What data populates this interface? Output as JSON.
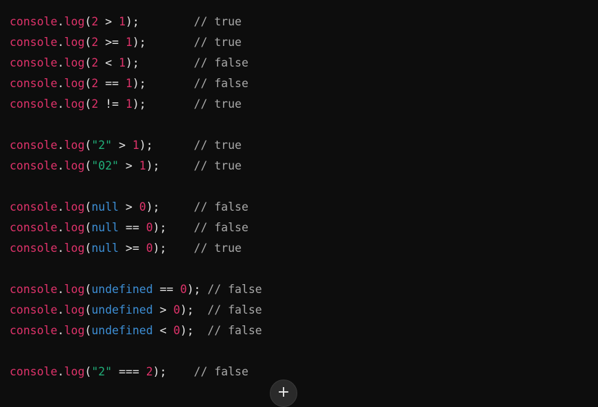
{
  "code": {
    "lines": [
      {
        "tokens": [
          [
            "obj",
            "console"
          ],
          [
            "op",
            "."
          ],
          [
            "fn",
            "log"
          ],
          [
            "op",
            "("
          ],
          [
            "num",
            "2"
          ],
          [
            "op",
            " > "
          ],
          [
            "num",
            "1"
          ],
          [
            "op",
            ");"
          ],
          [
            "op",
            "        "
          ],
          [
            "cm",
            "// true"
          ]
        ]
      },
      {
        "tokens": [
          [
            "obj",
            "console"
          ],
          [
            "op",
            "."
          ],
          [
            "fn",
            "log"
          ],
          [
            "op",
            "("
          ],
          [
            "num",
            "2"
          ],
          [
            "op",
            " >= "
          ],
          [
            "num",
            "1"
          ],
          [
            "op",
            ");"
          ],
          [
            "op",
            "       "
          ],
          [
            "cm",
            "// true"
          ]
        ]
      },
      {
        "tokens": [
          [
            "obj",
            "console"
          ],
          [
            "op",
            "."
          ],
          [
            "fn",
            "log"
          ],
          [
            "op",
            "("
          ],
          [
            "num",
            "2"
          ],
          [
            "op",
            " < "
          ],
          [
            "num",
            "1"
          ],
          [
            "op",
            ");"
          ],
          [
            "op",
            "        "
          ],
          [
            "cm",
            "// false"
          ]
        ]
      },
      {
        "tokens": [
          [
            "obj",
            "console"
          ],
          [
            "op",
            "."
          ],
          [
            "fn",
            "log"
          ],
          [
            "op",
            "("
          ],
          [
            "num",
            "2"
          ],
          [
            "op",
            " == "
          ],
          [
            "num",
            "1"
          ],
          [
            "op",
            ");"
          ],
          [
            "op",
            "       "
          ],
          [
            "cm",
            "// false"
          ]
        ]
      },
      {
        "tokens": [
          [
            "obj",
            "console"
          ],
          [
            "op",
            "."
          ],
          [
            "fn",
            "log"
          ],
          [
            "op",
            "("
          ],
          [
            "num",
            "2"
          ],
          [
            "op",
            " != "
          ],
          [
            "num",
            "1"
          ],
          [
            "op",
            ");"
          ],
          [
            "op",
            "       "
          ],
          [
            "cm",
            "// true"
          ]
        ]
      },
      {
        "blank": true
      },
      {
        "tokens": [
          [
            "obj",
            "console"
          ],
          [
            "op",
            "."
          ],
          [
            "fn",
            "log"
          ],
          [
            "op",
            "("
          ],
          [
            "str",
            "\"2\""
          ],
          [
            "op",
            " > "
          ],
          [
            "num",
            "1"
          ],
          [
            "op",
            ");"
          ],
          [
            "op",
            "      "
          ],
          [
            "cm",
            "// true"
          ]
        ]
      },
      {
        "tokens": [
          [
            "obj",
            "console"
          ],
          [
            "op",
            "."
          ],
          [
            "fn",
            "log"
          ],
          [
            "op",
            "("
          ],
          [
            "str",
            "\"02\""
          ],
          [
            "op",
            " > "
          ],
          [
            "num",
            "1"
          ],
          [
            "op",
            ");"
          ],
          [
            "op",
            "     "
          ],
          [
            "cm",
            "// true"
          ]
        ]
      },
      {
        "blank": true
      },
      {
        "tokens": [
          [
            "obj",
            "console"
          ],
          [
            "op",
            "."
          ],
          [
            "fn",
            "log"
          ],
          [
            "op",
            "("
          ],
          [
            "kw",
            "null"
          ],
          [
            "op",
            " > "
          ],
          [
            "num",
            "0"
          ],
          [
            "op",
            ");"
          ],
          [
            "op",
            "     "
          ],
          [
            "cm",
            "// false"
          ]
        ]
      },
      {
        "tokens": [
          [
            "obj",
            "console"
          ],
          [
            "op",
            "."
          ],
          [
            "fn",
            "log"
          ],
          [
            "op",
            "("
          ],
          [
            "kw",
            "null"
          ],
          [
            "op",
            " == "
          ],
          [
            "num",
            "0"
          ],
          [
            "op",
            ");"
          ],
          [
            "op",
            "    "
          ],
          [
            "cm",
            "// false"
          ]
        ]
      },
      {
        "tokens": [
          [
            "obj",
            "console"
          ],
          [
            "op",
            "."
          ],
          [
            "fn",
            "log"
          ],
          [
            "op",
            "("
          ],
          [
            "kw",
            "null"
          ],
          [
            "op",
            " >= "
          ],
          [
            "num",
            "0"
          ],
          [
            "op",
            ");"
          ],
          [
            "op",
            "    "
          ],
          [
            "cm",
            "// true"
          ]
        ]
      },
      {
        "blank": true
      },
      {
        "tokens": [
          [
            "obj",
            "console"
          ],
          [
            "op",
            "."
          ],
          [
            "fn",
            "log"
          ],
          [
            "op",
            "("
          ],
          [
            "kw",
            "undefined"
          ],
          [
            "op",
            " == "
          ],
          [
            "num",
            "0"
          ],
          [
            "op",
            ");"
          ],
          [
            "op",
            " "
          ],
          [
            "cm",
            "// false"
          ]
        ]
      },
      {
        "tokens": [
          [
            "obj",
            "console"
          ],
          [
            "op",
            "."
          ],
          [
            "fn",
            "log"
          ],
          [
            "op",
            "("
          ],
          [
            "kw",
            "undefined"
          ],
          [
            "op",
            " > "
          ],
          [
            "num",
            "0"
          ],
          [
            "op",
            ");"
          ],
          [
            "op",
            "  "
          ],
          [
            "cm",
            "// false"
          ]
        ]
      },
      {
        "tokens": [
          [
            "obj",
            "console"
          ],
          [
            "op",
            "."
          ],
          [
            "fn",
            "log"
          ],
          [
            "op",
            "("
          ],
          [
            "kw",
            "undefined"
          ],
          [
            "op",
            " < "
          ],
          [
            "num",
            "0"
          ],
          [
            "op",
            ");"
          ],
          [
            "op",
            "  "
          ],
          [
            "cm",
            "// false"
          ]
        ]
      },
      {
        "blank": true
      },
      {
        "tokens": [
          [
            "obj",
            "console"
          ],
          [
            "op",
            "."
          ],
          [
            "fn",
            "log"
          ],
          [
            "op",
            "("
          ],
          [
            "str",
            "\"2\""
          ],
          [
            "op",
            " === "
          ],
          [
            "num",
            "2"
          ],
          [
            "op",
            ");"
          ],
          [
            "op",
            "    "
          ],
          [
            "cm",
            "// false"
          ]
        ]
      }
    ]
  },
  "scroll_button": {
    "icon": "plus-icon",
    "glyph": "+"
  },
  "colors": {
    "background": "#0d0d0d",
    "identifier": "#e0336b",
    "string": "#21b07a",
    "keyword": "#3d8fd6",
    "comment": "#a9a9a9",
    "plain": "#e6e6e6"
  }
}
